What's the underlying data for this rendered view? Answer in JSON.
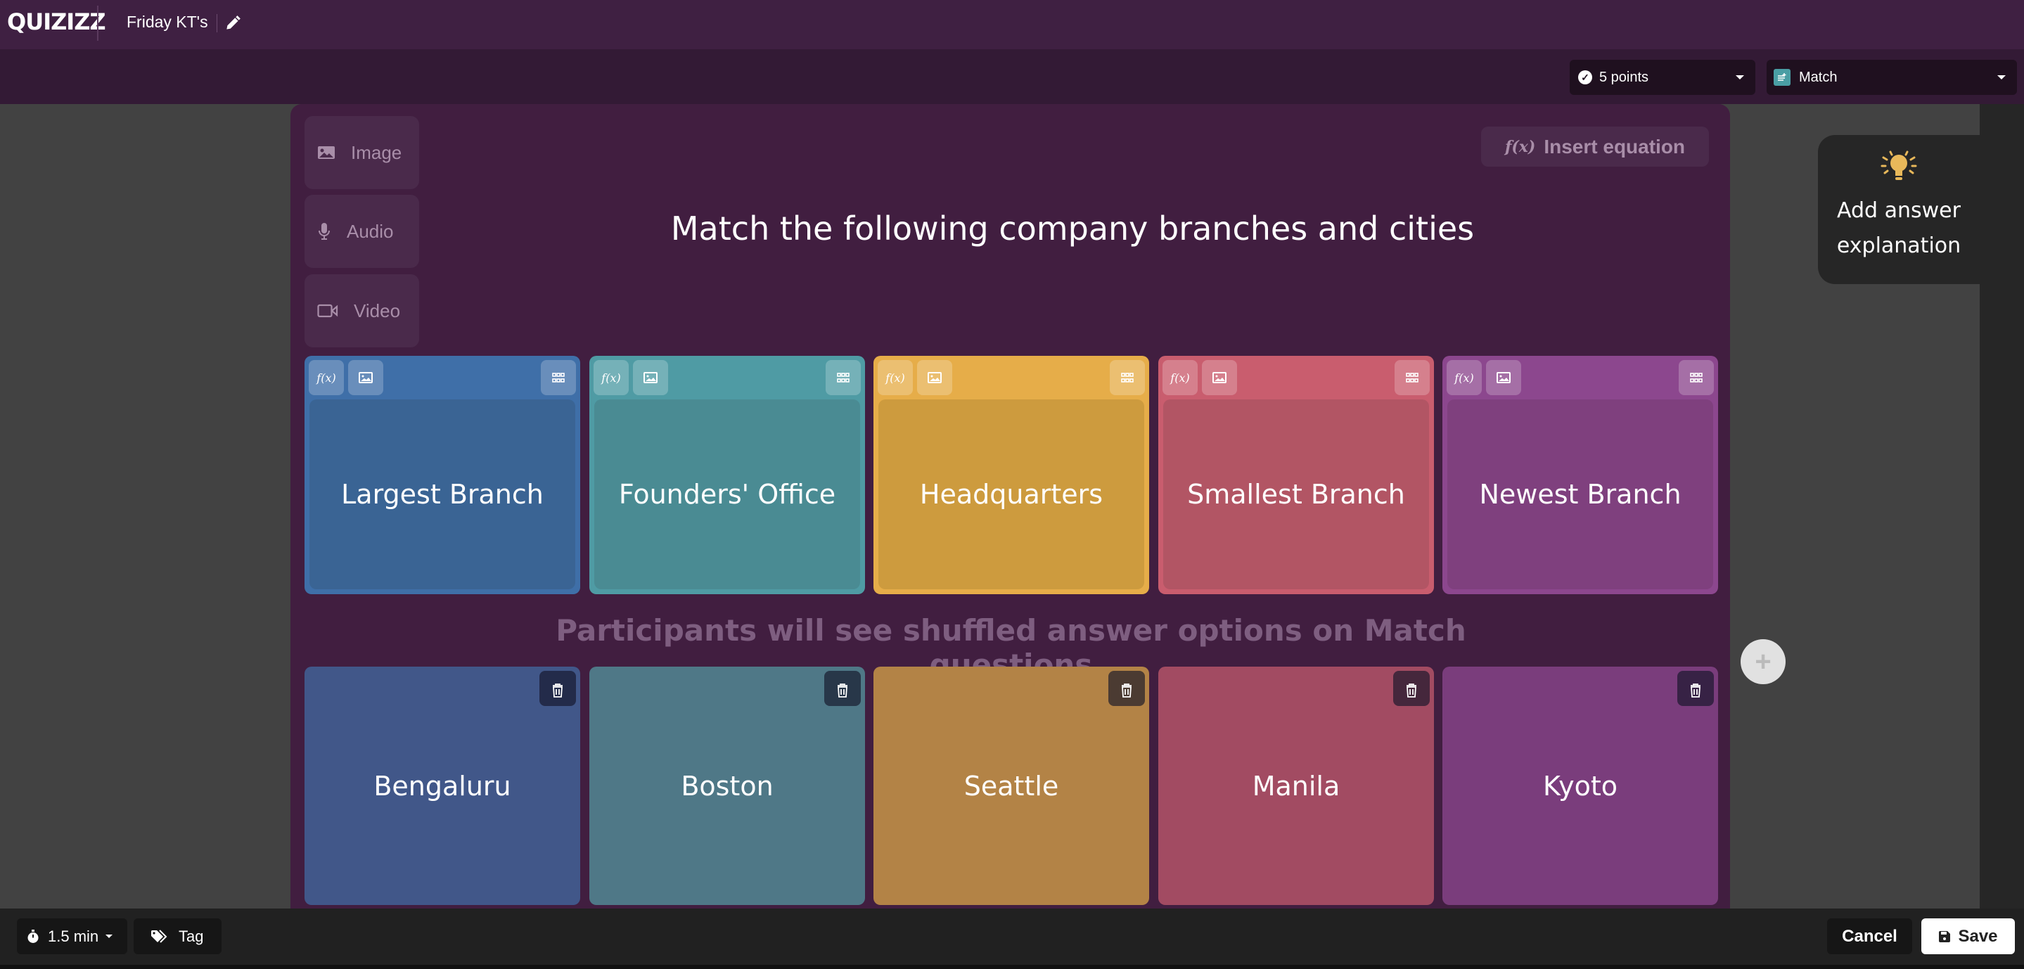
{
  "header": {
    "logo": "QUIZIZZ",
    "quiz_title": "Friday KT's",
    "edit_icon": "pencil-icon"
  },
  "settings": {
    "points_label": "5 points",
    "points_icon": "check-circle-icon",
    "question_type": "Match",
    "question_type_icon": "match-icon"
  },
  "media": {
    "image_label": "Image",
    "audio_label": "Audio",
    "video_label": "Video"
  },
  "insert_equation_label": "Insert equation",
  "question_text": "Match the following company branches and cities",
  "shuffle_note": "Participants will see shuffled answer options on Match questions",
  "prompts": [
    {
      "text": "Largest Branch",
      "color": "#3f6fa8",
      "body_color": "#3a6494",
      "btn_color": "#3f6fa8"
    },
    {
      "text": "Founders' Office",
      "color": "#4f9ba4",
      "body_color": "#4a8b93"
    },
    {
      "text": "Headquarters",
      "color": "#e6ad49",
      "body_color": "#cd9b3e"
    },
    {
      "text": "Smallest Branch",
      "color": "#c95d6e",
      "body_color": "#b25564"
    },
    {
      "text": "Newest Branch",
      "color": "#8c478e",
      "body_color": "#7f407e"
    }
  ],
  "answers": [
    {
      "text": "Bengaluru",
      "color": "#415789"
    },
    {
      "text": "Boston",
      "color": "#4f7887"
    },
    {
      "text": "Seattle",
      "color": "#b38346"
    },
    {
      "text": "Manila",
      "color": "#a24b62"
    },
    {
      "text": "Kyoto",
      "color": "#7a3d7c"
    }
  ],
  "explanation": {
    "label": "Add answer explanation",
    "icon": "lightbulb-icon",
    "icon_color": "#e8b85a"
  },
  "footer": {
    "time_label": "1.5 min",
    "tag_label": "Tag",
    "cancel_label": "Cancel",
    "save_label": "Save"
  }
}
